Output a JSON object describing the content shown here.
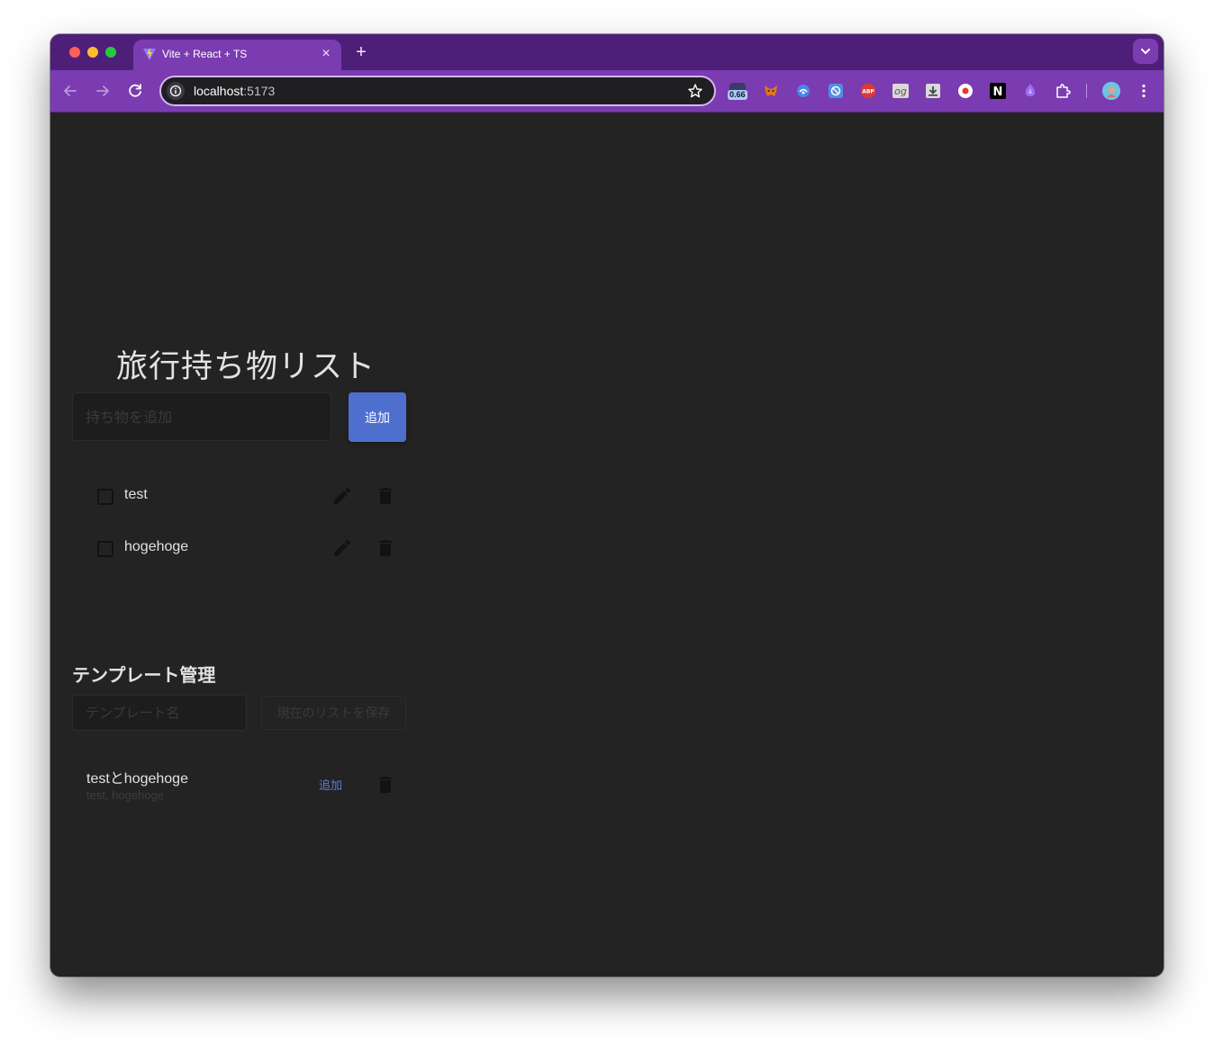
{
  "browser": {
    "tab": {
      "title": "Vite + React + TS",
      "close_glyph": "×"
    },
    "new_tab_glyph": "+",
    "address_bar": {
      "host": "localhost",
      "port": ":5173"
    },
    "extensions": [
      {
        "name": "reading-time-ext-icon",
        "badge": "0.66",
        "color": "#3b3b6a"
      },
      {
        "name": "metamask-icon",
        "color": "#e2761b"
      },
      {
        "name": "blue-ext-icon",
        "color": "#4a86e8"
      },
      {
        "name": "blocker-ext-icon",
        "color": "#4b8fe6"
      },
      {
        "name": "abp-icon",
        "label": "ABP",
        "color": "#d83a3a"
      },
      {
        "name": "og-ext-icon",
        "label": "og",
        "color": "#d9d9d9"
      },
      {
        "name": "download-ext-icon",
        "color": "#d9d9d9"
      },
      {
        "name": "record-ext-icon",
        "color": "#ffffff"
      },
      {
        "name": "notion-icon",
        "label": "N",
        "color": "#000000"
      },
      {
        "name": "purple-ext-icon",
        "color": "#9b6ef0"
      },
      {
        "name": "puzzle-icon",
        "color": "#ffffff"
      }
    ],
    "accent_color": "#7a3cb0"
  },
  "app": {
    "title": "旅行持ち物リスト",
    "add_input": {
      "placeholder": "持ち物を追加",
      "value": ""
    },
    "add_button_label": "追加",
    "items": [
      {
        "label": "test",
        "checked": false
      },
      {
        "label": "hogehoge",
        "checked": false
      }
    ],
    "template_section": {
      "title": "テンプレート管理",
      "name_input_placeholder": "テンプレート名",
      "save_button_label": "現在のリストを保存",
      "templates": [
        {
          "name": "testとhogehoge",
          "items_summary": "test, hogehoge",
          "add_label": "追加"
        }
      ]
    },
    "colors": {
      "background": "#232323",
      "primary_button": "#4f6fcf",
      "link": "#5a7fd6"
    }
  }
}
